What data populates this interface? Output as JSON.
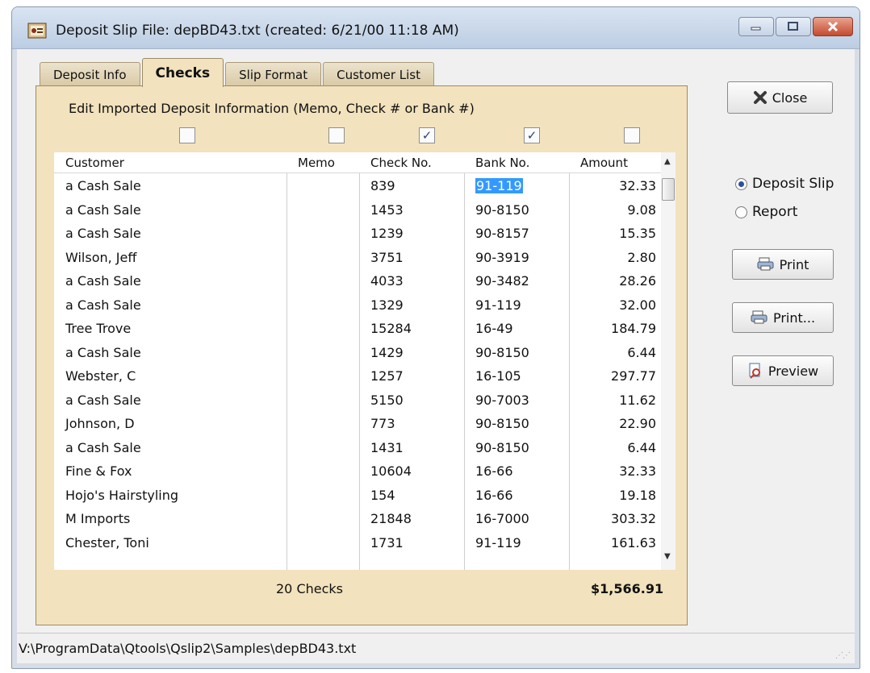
{
  "window": {
    "title": "Deposit Slip File:  depBD43.txt  (created: 6/21/00 11:18 AM)"
  },
  "tabs": [
    {
      "label": "Deposit Info",
      "active": false
    },
    {
      "label": "Checks",
      "active": true
    },
    {
      "label": "Slip Format",
      "active": false
    },
    {
      "label": "Customer List",
      "active": false
    }
  ],
  "panel": {
    "edit_label": "Edit Imported Deposit Information (Memo, Check # or Bank #)",
    "header_checkboxes": [
      {
        "column": "Customer",
        "checked": false
      },
      {
        "column": "Memo",
        "checked": false
      },
      {
        "column": "Check No.",
        "checked": true
      },
      {
        "column": "Bank No.",
        "checked": true
      },
      {
        "column": "Amount",
        "checked": false
      }
    ],
    "check_mark": "✓"
  },
  "table": {
    "columns": [
      "Customer",
      "Memo",
      "Check No.",
      "Bank No.",
      "Amount"
    ],
    "rows": [
      {
        "customer": "a Cash Sale",
        "memo": "",
        "check": "839",
        "bank": "91-119",
        "amount": "32.33"
      },
      {
        "customer": "a Cash Sale",
        "memo": "",
        "check": "1453",
        "bank": "90-8150",
        "amount": "9.08"
      },
      {
        "customer": "a Cash Sale",
        "memo": "",
        "check": "1239",
        "bank": "90-8157",
        "amount": "15.35"
      },
      {
        "customer": "Wilson, Jeff",
        "memo": "",
        "check": "3751",
        "bank": "90-3919",
        "amount": "2.80"
      },
      {
        "customer": "a Cash Sale",
        "memo": "",
        "check": "4033",
        "bank": "90-3482",
        "amount": "28.26"
      },
      {
        "customer": "a Cash Sale",
        "memo": "",
        "check": "1329",
        "bank": "91-119",
        "amount": "32.00"
      },
      {
        "customer": "Tree Trove",
        "memo": "",
        "check": "15284",
        "bank": "16-49",
        "amount": "184.79"
      },
      {
        "customer": "a Cash Sale",
        "memo": "",
        "check": "1429",
        "bank": "90-8150",
        "amount": "6.44"
      },
      {
        "customer": "Webster, C",
        "memo": "",
        "check": "1257",
        "bank": "16-105",
        "amount": "297.77"
      },
      {
        "customer": "a Cash Sale",
        "memo": "",
        "check": "5150",
        "bank": "90-7003",
        "amount": "11.62"
      },
      {
        "customer": "Johnson, D",
        "memo": "",
        "check": "773",
        "bank": "90-8150",
        "amount": "22.90"
      },
      {
        "customer": "a Cash Sale",
        "memo": "",
        "check": "1431",
        "bank": "90-8150",
        "amount": "6.44"
      },
      {
        "customer": "Fine & Fox",
        "memo": "",
        "check": "10604",
        "bank": "16-66",
        "amount": "32.33"
      },
      {
        "customer": "Hojo's Hairstyling",
        "memo": "",
        "check": "154",
        "bank": "16-66",
        "amount": "19.18"
      },
      {
        "customer": "M Imports",
        "memo": "",
        "check": "21848",
        "bank": "16-7000",
        "amount": "303.32"
      },
      {
        "customer": "Chester, Toni",
        "memo": "",
        "check": "1731",
        "bank": "91-119",
        "amount": "161.63"
      }
    ],
    "selected_cell": {
      "row": 0,
      "column": "Bank No."
    }
  },
  "footer": {
    "count": "20 Checks",
    "total": "$1,566.91"
  },
  "sidebar": {
    "close_label": "Close",
    "radio_options": [
      {
        "label": "Deposit Slip",
        "selected": true
      },
      {
        "label": "Report",
        "selected": false
      }
    ],
    "print_label": "Print",
    "print_dialog_label": "Print...",
    "preview_label": "Preview"
  },
  "status": {
    "path": "V:\\ProgramData\\Qtools\\Qslip2\\Samples\\depBD43.txt"
  },
  "colors": {
    "panel_bg": "#f2e2bd",
    "tab_bg": "#d9c9a5",
    "selection": "#3399ff",
    "close_x": "#3a3a3a"
  }
}
